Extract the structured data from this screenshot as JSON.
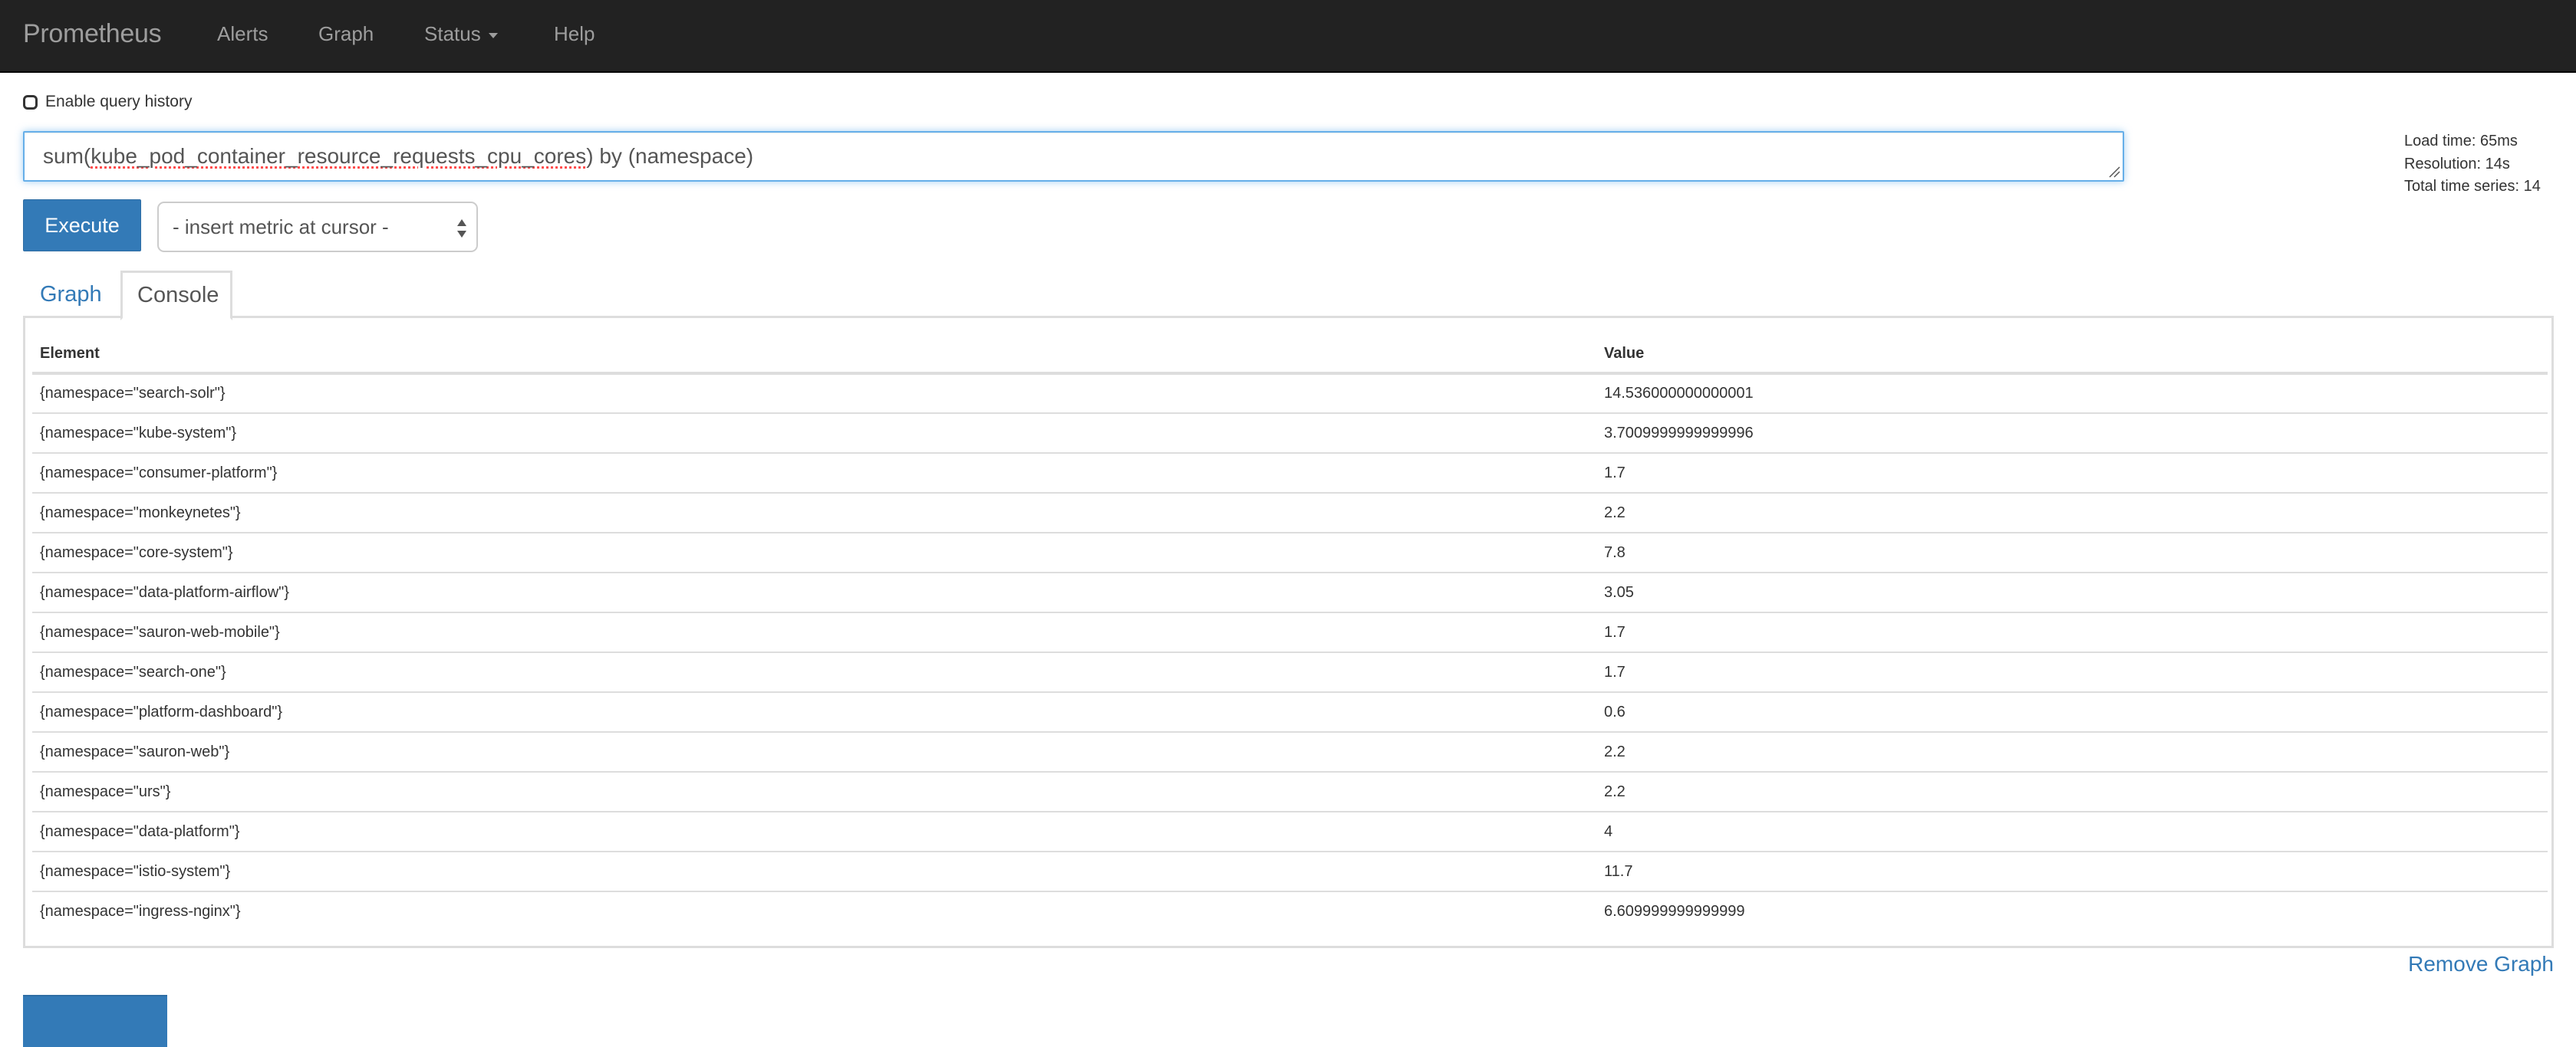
{
  "navbar": {
    "brand": "Prometheus",
    "items": [
      {
        "label": "Alerts"
      },
      {
        "label": "Graph"
      },
      {
        "label": "Status",
        "has_dropdown": true
      },
      {
        "label": "Help"
      }
    ]
  },
  "query_history": {
    "label": "Enable query history",
    "checked": false
  },
  "expression": {
    "prefix": "sum(",
    "metric": "kube_pod_container_resource_requests_cpu_cores",
    "suffix": ") by (namespace)"
  },
  "stats": {
    "load_time": "Load time: 65ms",
    "resolution": "Resolution: 14s",
    "total_series": "Total time series: 14"
  },
  "controls": {
    "execute_label": "Execute",
    "metric_select_value": "- insert metric at cursor -"
  },
  "tabs": [
    {
      "label": "Graph",
      "active": false
    },
    {
      "label": "Console",
      "active": true
    }
  ],
  "table": {
    "headers": [
      "Element",
      "Value"
    ],
    "rows": [
      {
        "element": "{namespace=\"search-solr\"}",
        "value": "14.536000000000001"
      },
      {
        "element": "{namespace=\"kube-system\"}",
        "value": "3.7009999999999996"
      },
      {
        "element": "{namespace=\"consumer-platform\"}",
        "value": "1.7"
      },
      {
        "element": "{namespace=\"monkeynetes\"}",
        "value": "2.2"
      },
      {
        "element": "{namespace=\"core-system\"}",
        "value": "7.8"
      },
      {
        "element": "{namespace=\"data-platform-airflow\"}",
        "value": "3.05"
      },
      {
        "element": "{namespace=\"sauron-web-mobile\"}",
        "value": "1.7"
      },
      {
        "element": "{namespace=\"search-one\"}",
        "value": "1.7"
      },
      {
        "element": "{namespace=\"platform-dashboard\"}",
        "value": "0.6"
      },
      {
        "element": "{namespace=\"sauron-web\"}",
        "value": "2.2"
      },
      {
        "element": "{namespace=\"urs\"}",
        "value": "2.2"
      },
      {
        "element": "{namespace=\"data-platform\"}",
        "value": "4"
      },
      {
        "element": "{namespace=\"istio-system\"}",
        "value": "11.7"
      },
      {
        "element": "{namespace=\"ingress-nginx\"}",
        "value": "6.609999999999999"
      }
    ]
  },
  "remove_graph_label": "Remove Graph",
  "colors": {
    "navbar_bg": "#222222",
    "navbar_text": "#9d9d9d",
    "primary": "#337ab7",
    "focus_border": "#66afe9",
    "table_border": "#dddddd"
  }
}
